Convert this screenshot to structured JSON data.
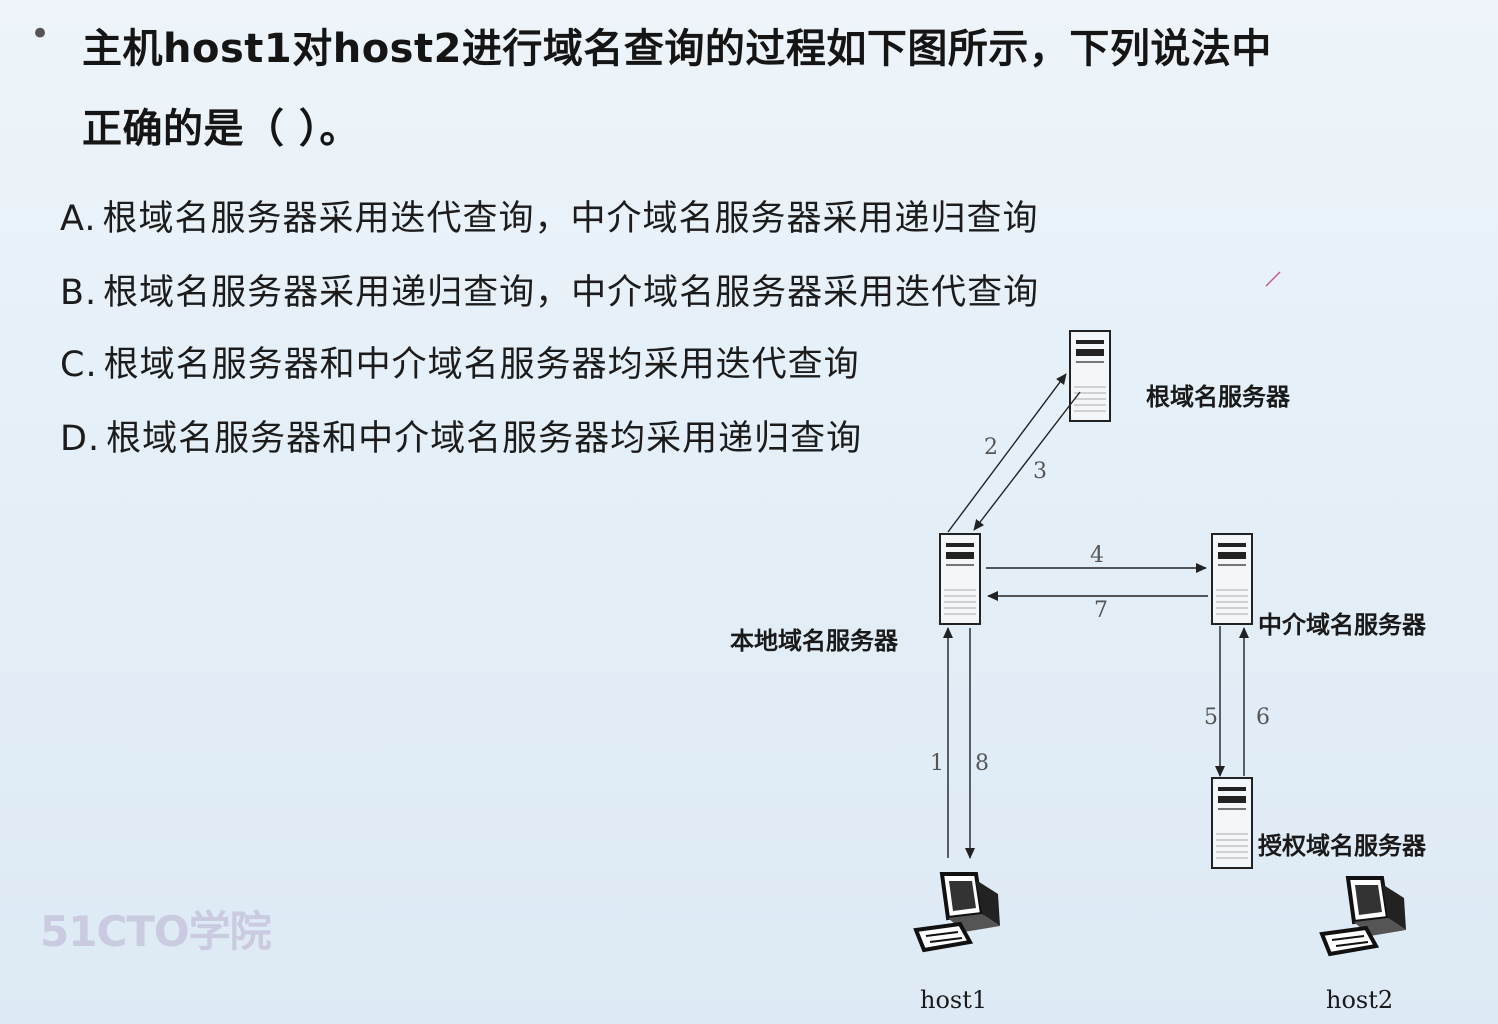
{
  "question": {
    "bullet": "•",
    "line1": "主机host1对host2进行域名查询的过程如下图所示，下列说法中",
    "line2": "正确的是（ ）。"
  },
  "options": [
    {
      "key": "A.",
      "text": "根域名服务器采用迭代查询，中介域名服务器采用递归查询"
    },
    {
      "key": "B.",
      "text": "根域名服务器采用递归查询，中介域名服务器采用迭代查询"
    },
    {
      "key": "C.",
      "text": "根域名服务器和中介域名服务器均采用迭代查询"
    },
    {
      "key": "D.",
      "text": "根域名服务器和中介域名服务器均采用递归查询"
    }
  ],
  "diagram": {
    "servers": {
      "root": "根域名服务器",
      "local": "本地域名服务器",
      "intermediate": "中介域名服务器",
      "authoritative": "授权域名服务器"
    },
    "hosts": {
      "host1": "host1",
      "host2": "host2"
    },
    "steps": {
      "s1": "1",
      "s2": "2",
      "s3": "3",
      "s4": "4",
      "s5": "5",
      "s6": "6",
      "s7": "7",
      "s8": "8"
    }
  },
  "watermark": "51CTO学院"
}
